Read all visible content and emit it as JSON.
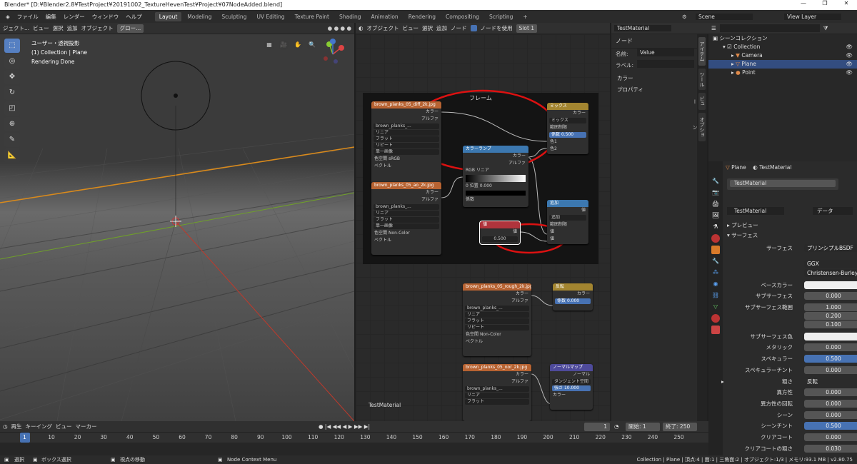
{
  "titlebar": {
    "text": "Blender* [D:¥Blender2.8¥TestProject¥20191002_TextureHevenTest¥Project¥07NodeAdded.blend]",
    "controls": [
      "—",
      "❐",
      "✕"
    ]
  },
  "menu": {
    "items": [
      "ファイル",
      "編集",
      "レンダー",
      "ウィンドウ",
      "ヘルプ"
    ],
    "workspaces": [
      "Layout",
      "Modeling",
      "Sculpting",
      "UV Editing",
      "Texture Paint",
      "Shading",
      "Animation",
      "Rendering",
      "Compositing",
      "Scripting"
    ],
    "active_workspace": "Layout",
    "add_tab": "+",
    "scene": "Scene",
    "view_layer": "View Layer"
  },
  "viewport": {
    "header": [
      "ジェクト...",
      "ビュー",
      "選択",
      "追加",
      "オブジェクト",
      "グロー..."
    ],
    "info": [
      "ユーザー・透視投影",
      "(1) Collection | Plane",
      "Rendering Done"
    ],
    "tools": [
      "select-tool",
      "cursor-tool",
      "move-tool",
      "rotate-tool",
      "scale-tool",
      "transform-tool",
      "annotate-tool",
      "measure-tool"
    ]
  },
  "node_editor": {
    "header": [
      "オブジェクト",
      "ビュー",
      "選択",
      "追加",
      "ノード",
      "ノードを使用",
      "Slot 1",
      "TestMaterial"
    ],
    "frame_title": "フレーム",
    "material_label": "TestMaterial",
    "img1": {
      "title": "brown_planks_05_diff_2k.jpg",
      "outs": [
        "カラー",
        "アルファ"
      ],
      "file": "brown_planks_...",
      "opts": [
        "リニア",
        "フラット",
        "リピート",
        "単一画像"
      ],
      "cs_label": "色空間",
      "cs": "sRGB",
      "vec": "ベクトル"
    },
    "img2": {
      "title": "brown_planks_05_ao_2k.jpg",
      "outs": [
        "カラー",
        "アルファ"
      ],
      "file": "brown_planks_...",
      "opts": [
        "リニア",
        "フラット",
        "リピート",
        "単一画像"
      ],
      "cs_label": "色空間",
      "cs": "Non-Color",
      "vec": "ベクトル"
    },
    "ramp": {
      "title": "カラーランプ",
      "outs": [
        "カラー",
        "アルファ"
      ],
      "mode": "RGB",
      "interp": "リニア",
      "idx": "0",
      "pos_label": "位置",
      "pos": "0.000",
      "fac": "係数"
    },
    "mix": {
      "title": "ミックス",
      "out": "カラー",
      "blend": "ミックス",
      "clamp": "範囲制限",
      "fac_label": "係数",
      "fac": "0.500",
      "c1": "色1",
      "c2": "色2"
    },
    "val": {
      "title": "値",
      "out": "値",
      "value": "0.500"
    },
    "math": {
      "title": "追加",
      "out": "値",
      "op": "追加",
      "clamp": "範囲制限",
      "v1": "値",
      "v2": "値"
    },
    "img3": {
      "title": "brown_planks_05_rough_2k.jpg",
      "outs": [
        "カラー",
        "アルファ"
      ],
      "file": "brown_planks_...",
      "opts": [
        "リニア",
        "フラット",
        "リピート",
        "単一画像"
      ],
      "cs_label": "色空間",
      "cs": "Non-Color",
      "vec": "ベクトル"
    },
    "invert": {
      "title": "反転",
      "out": "カラー",
      "fac_label": "係数",
      "fac": "0.000",
      "col": "カラー"
    },
    "img4": {
      "title": "brown_planks_05_nor_2k.jpg",
      "outs": [
        "カラー",
        "アルファ"
      ],
      "file": "brown_planks_...",
      "opts": [
        "リニア",
        "フラット",
        "リピート",
        "単一画像"
      ]
    },
    "normal": {
      "title": "ノーマルマップ",
      "out": "ノーマル",
      "space": "タンジェント空間",
      "str_label": "強さ",
      "strength": "10.000",
      "col": "カラー"
    }
  },
  "npanel": {
    "title": "ノード",
    "name_label": "名前:",
    "name": "Value",
    "label_label": "ラベル:",
    "color": "カラー",
    "props": "プロパティ",
    "tabs": [
      "アイテム",
      "ツール",
      "ビュー",
      "オプション"
    ]
  },
  "outliner": {
    "title": "シーンコレクション",
    "rows": [
      "Collection",
      "Camera",
      "Plane",
      "Point"
    ]
  },
  "props": {
    "object": "Plane",
    "material": "TestMaterial",
    "slot": "TestMaterial",
    "mat_name": "TestMaterial",
    "data": "データ",
    "preview": "プレビュー",
    "surface_section": "サーフェス",
    "surface_label": "サーフェス",
    "surface": "プリンシプルBSDF",
    "dist": "GGX",
    "sss_method": "Christensen-Burley",
    "rows": [
      {
        "label": "ベースカラー",
        "value": "",
        "kind": "white"
      },
      {
        "label": "サブサーフェス",
        "value": "0.000",
        "kind": ""
      },
      {
        "label": "サブサーフェス範囲",
        "value": "1.000",
        "kind": ""
      },
      {
        "label": "",
        "value": "0.200",
        "kind": ""
      },
      {
        "label": "",
        "value": "0.100",
        "kind": ""
      },
      {
        "label": "サブサーフェス色",
        "value": "",
        "kind": "white"
      },
      {
        "label": "メタリック",
        "value": "0.000",
        "kind": ""
      },
      {
        "label": "スペキュラー",
        "value": "0.500",
        "kind": "blue"
      },
      {
        "label": "スペキュラーチント",
        "value": "0.000",
        "kind": ""
      },
      {
        "label": "粗さ",
        "value": "反転",
        "kind": "drop"
      },
      {
        "label": "異方性",
        "value": "0.000",
        "kind": ""
      },
      {
        "label": "異方性の回転",
        "value": "0.000",
        "kind": ""
      },
      {
        "label": "シーン",
        "value": "0.000",
        "kind": ""
      },
      {
        "label": "シーンチント",
        "value": "0.500",
        "kind": "blue"
      },
      {
        "label": "クリアコート",
        "value": "0.000",
        "kind": ""
      },
      {
        "label": "クリアコートの粗さ",
        "value": "0.030",
        "kind": ""
      }
    ]
  },
  "timeline": {
    "menu": [
      "再生",
      "キーイング",
      "ビュー",
      "マーカー"
    ],
    "current": "1",
    "start_label": "開始:",
    "start": "1",
    "end_label": "終了:",
    "end": "250",
    "ticks": [
      "1",
      "10",
      "20",
      "30",
      "40",
      "50",
      "60",
      "70",
      "80",
      "90",
      "100",
      "110",
      "120",
      "130",
      "140",
      "150",
      "160",
      "170",
      "180",
      "190",
      "200",
      "210",
      "220",
      "230",
      "240",
      "250"
    ]
  },
  "status": {
    "items": [
      "選択",
      "ボックス選択",
      "視点の移動",
      "Node Context Menu"
    ],
    "right": "Collection | Plane | 頂点:4 | 面:1 | 三角面:2 | オブジェクト:1/3 | メモリ:93.1 MB | v2.80.75"
  }
}
